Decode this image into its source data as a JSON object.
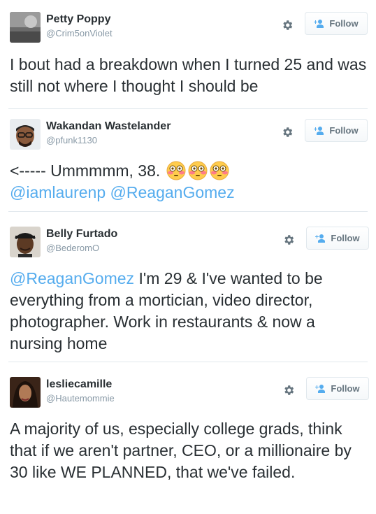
{
  "tweets": [
    {
      "name": "Petty Poppy",
      "handle": "@Crim5onViolet",
      "follow_label": "Follow",
      "text_plain": "I bout had a breakdown when I turned 25 and was still not where I thought I should be"
    },
    {
      "name": "Wakandan Wastelander",
      "handle": "@pfunk1130",
      "follow_label": "Follow",
      "text_prefix": "<----- Ummmmm, 38.",
      "emoji": [
        "flushed-face-emoji",
        "flushed-face-emoji",
        "flushed-face-emoji"
      ],
      "mention_1": "@iamlaurenp",
      "mention_2": "@ReaganGomez"
    },
    {
      "name": "Belly Furtado",
      "handle": "@BederomO",
      "follow_label": "Follow",
      "mention": "@ReaganGomez",
      "text_after_mention": "I'm 29 & I've wanted to be everything from a mortician, video director, photographer. Work in restaurants & now a nursing home"
    },
    {
      "name": "lesliecamille",
      "handle": "@Hautemommie",
      "follow_label": "Follow",
      "text_plain": "A majority of us, especially college grads, think that if we aren't partner, CEO, or a millionaire by 30 like WE PLANNED, that we've failed."
    }
  ],
  "colors": {
    "link": "#55acee",
    "text": "#292f33",
    "secondary": "#8899a6",
    "follow_icon": "#55acee"
  },
  "icons": {
    "settings": "gear-icon",
    "follow": "add-person-icon"
  }
}
